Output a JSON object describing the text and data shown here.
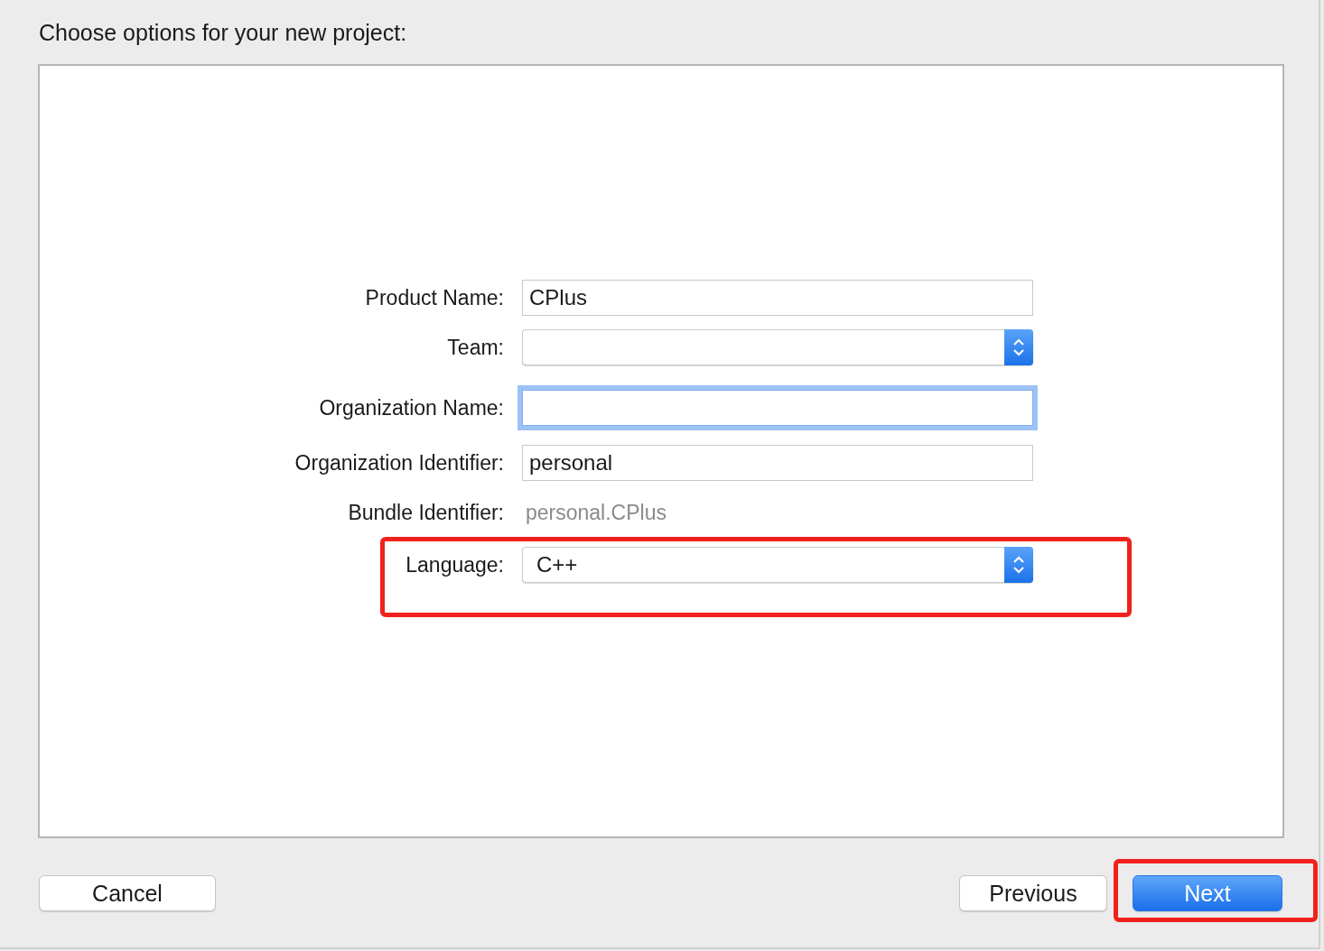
{
  "heading": "Choose options for your new project:",
  "fields": [
    {
      "kind": "text",
      "label": "Product Name:",
      "value": "CPlus",
      "focused": false,
      "highlighted": false
    },
    {
      "kind": "popup",
      "label": "Team:",
      "highlighted": false
    },
    {
      "kind": "text",
      "label": "Organization Name:",
      "focused": true,
      "highlighted": false
    },
    {
      "kind": "text",
      "label": "Organization Identifier:",
      "value": "personal",
      "focused": false,
      "highlighted": false
    },
    {
      "kind": "static",
      "label": "Bundle Identifier:",
      "value": "personal.CPlus",
      "highlighted": false
    },
    {
      "kind": "popup",
      "label": "Language:",
      "value": "C++",
      "highlighted": true
    }
  ],
  "buttons": [
    {
      "label": "Cancel",
      "kind": "plain",
      "highlighted": false
    },
    {
      "label": "Previous",
      "kind": "plain",
      "highlighted": false
    },
    {
      "label": "Next",
      "kind": "default",
      "highlighted": true
    }
  ]
}
